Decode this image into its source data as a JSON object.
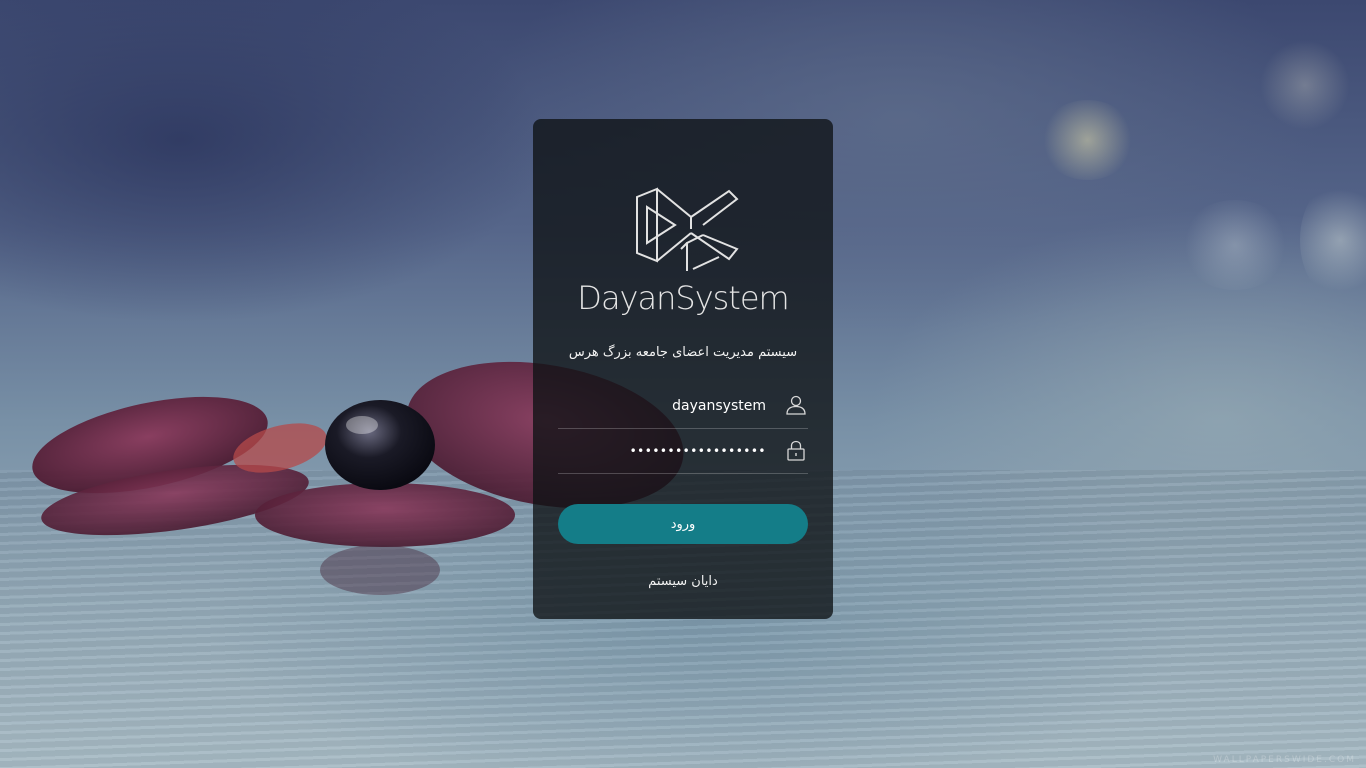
{
  "brand": {
    "logo_icon": "dayansystem-logo-mark",
    "wordmark": "DayanSystem"
  },
  "login": {
    "title": "سیستم مدیریت اعضای جامعه بزرگ هرس",
    "username": {
      "icon": "user-icon",
      "value": "dayansystem"
    },
    "password": {
      "icon": "lock-icon",
      "value": "••••••••••••••••••"
    },
    "submit_label": "ورود",
    "footer": "دایان سیستم"
  },
  "background": {
    "watermark": "WALLPAPERSWIDE.COM"
  },
  "colors": {
    "accent": "#147d88",
    "card": "#0e1214",
    "text": "#ffffff"
  }
}
